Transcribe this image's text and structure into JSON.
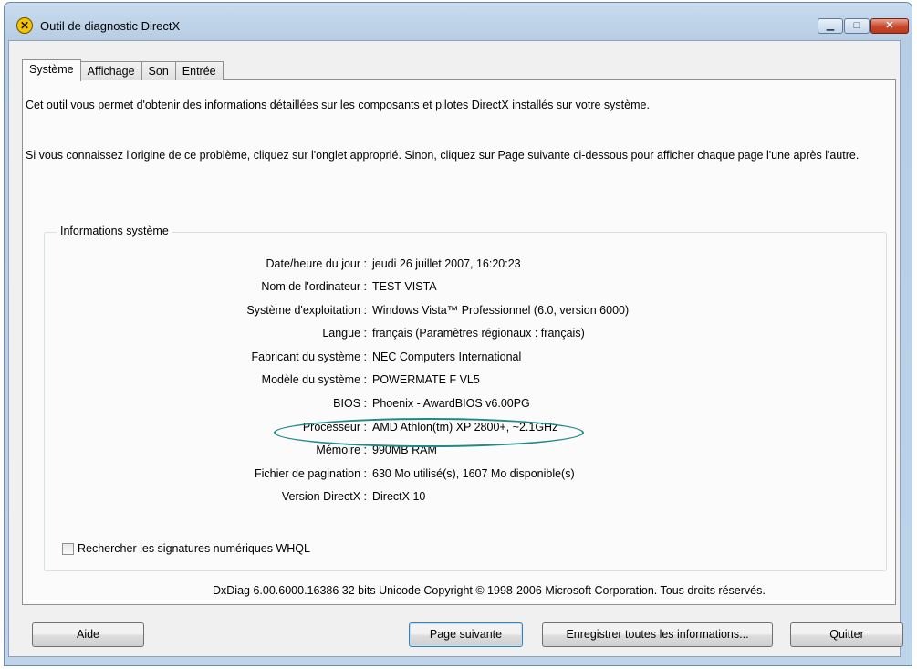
{
  "window": {
    "title": "Outil de diagnostic DirectX",
    "icon": "directx-icon"
  },
  "tabs": [
    {
      "label": "Système",
      "active": true
    },
    {
      "label": "Affichage",
      "active": false
    },
    {
      "label": "Son",
      "active": false
    },
    {
      "label": "Entrée",
      "active": false
    }
  ],
  "intro": {
    "line1": "Cet outil vous permet d'obtenir des informations détaillées sur les composants et pilotes DirectX installés sur votre système.",
    "line2": "Si vous connaissez l'origine de ce problème, cliquez sur l'onglet approprié. Sinon, cliquez sur Page suivante ci-dessous pour afficher chaque page l'une après l'autre."
  },
  "system_info": {
    "group_title": "Informations système",
    "rows": [
      {
        "label": "Date/heure du jour :",
        "value": "jeudi 26 juillet 2007, 16:20:23"
      },
      {
        "label": "Nom de l'ordinateur :",
        "value": "TEST-VISTA"
      },
      {
        "label": "Système d'exploitation :",
        "value": "Windows Vista™ Professionnel (6.0, version 6000)"
      },
      {
        "label": "Langue :",
        "value": "français (Paramètres régionaux : français)"
      },
      {
        "label": "Fabricant du système :",
        "value": "NEC Computers International"
      },
      {
        "label": "Modèle du système :",
        "value": "POWERMATE F VL5"
      },
      {
        "label": "BIOS :",
        "value": "Phoenix - AwardBIOS v6.00PG"
      },
      {
        "label": "Processeur :",
        "value": "AMD Athlon(tm) XP 2800+, ~2.1GHz"
      },
      {
        "label": "Mémoire :",
        "value": "990MB RAM"
      },
      {
        "label": "Fichier de pagination :",
        "value": "630 Mo utilisé(s), 1607 Mo disponible(s)"
      },
      {
        "label": "Version DirectX :",
        "value": "DirectX 10"
      }
    ]
  },
  "whql_checkbox": {
    "label": "Rechercher les signatures numériques WHQL",
    "checked": false
  },
  "copyright": "DxDiag 6.00.6000.16386 32 bits Unicode Copyright © 1998-2006 Microsoft Corporation. Tous droits réservés.",
  "buttons": {
    "help": "Aide",
    "next": "Page suivante",
    "save": "Enregistrer toutes les informations...",
    "quit": "Quitter"
  },
  "colors": {
    "highlight_oval": "#1f8a86",
    "close_button": "#c9462c"
  }
}
